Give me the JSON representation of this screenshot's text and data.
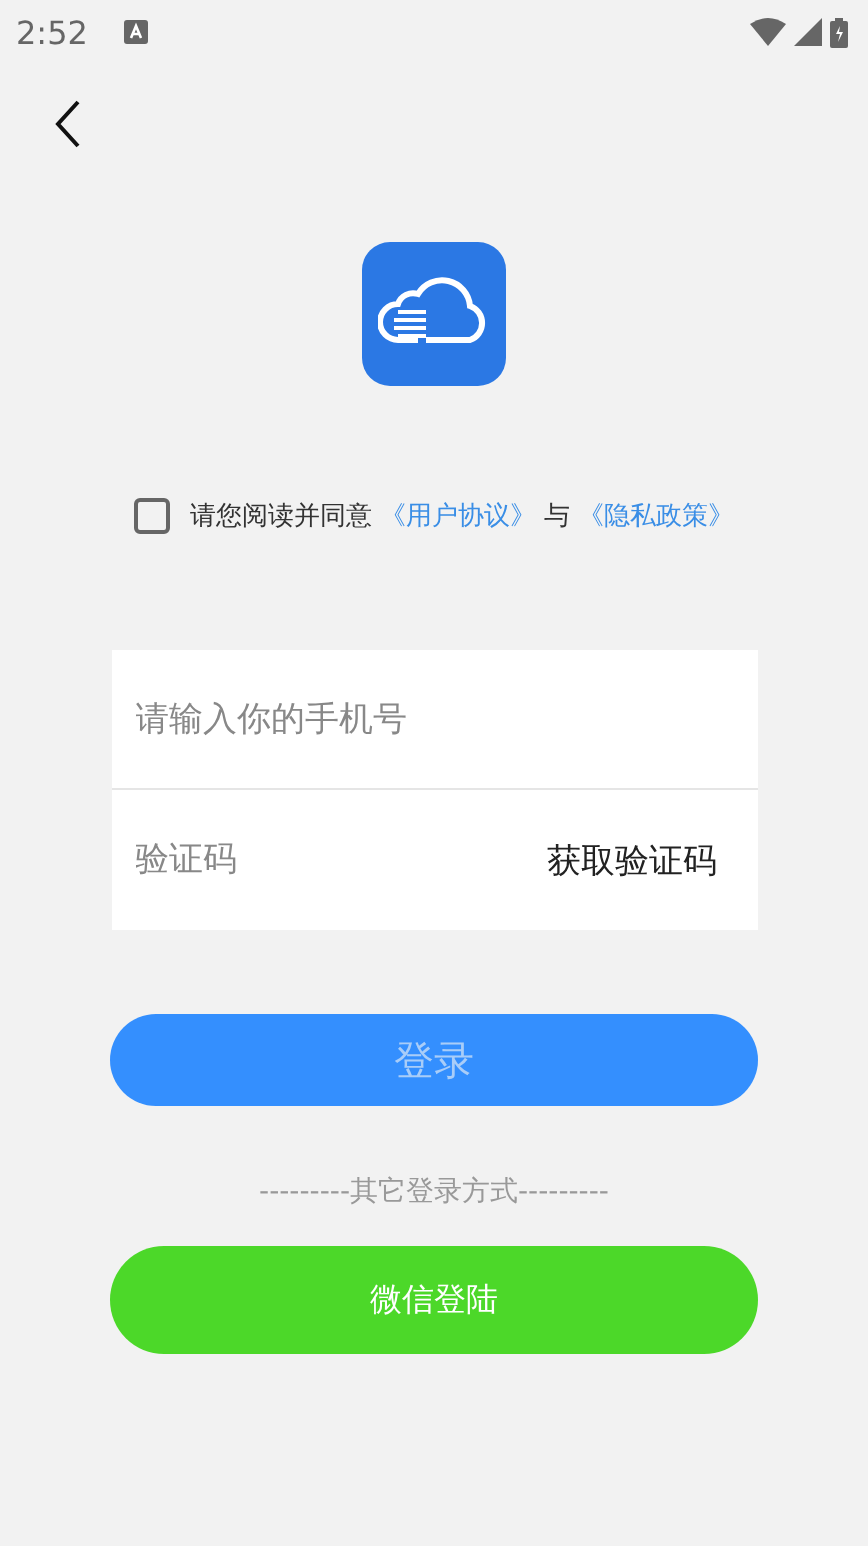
{
  "status_bar": {
    "time": "2:52"
  },
  "agreement": {
    "checked": false,
    "prefix": "请您阅读并同意",
    "link_1": "《用户协议》",
    "joiner": "与",
    "link_2": "《隐私政策》"
  },
  "phone_field": {
    "placeholder": "请输入你的手机号"
  },
  "code_field": {
    "placeholder": "验证码",
    "action": "获取验证码"
  },
  "login_button": {
    "label": "登录",
    "disabled": true
  },
  "divider_text": "---------其它登录方式---------",
  "wechat_button": {
    "label": "微信登陆"
  }
}
